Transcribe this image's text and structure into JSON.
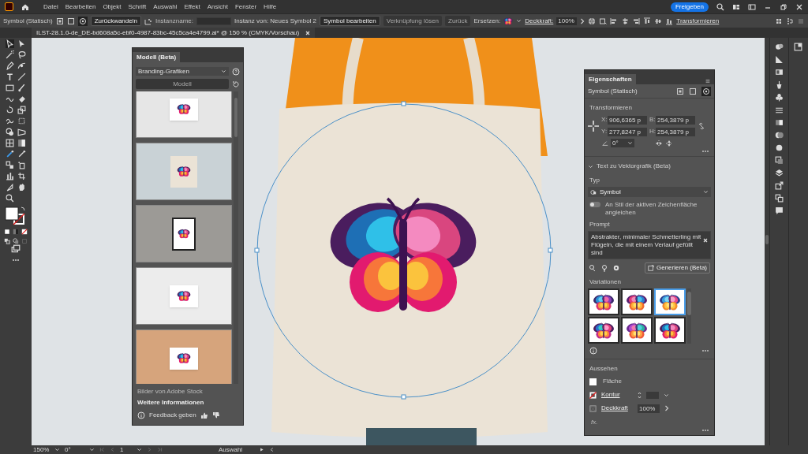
{
  "menu_bar": {
    "items": [
      "Datei",
      "Bearbeiten",
      "Objekt",
      "Schrift",
      "Auswahl",
      "Effekt",
      "Ansicht",
      "Fenster",
      "Hilfe"
    ],
    "share_button": "Freigeben"
  },
  "control_bar": {
    "object_type": "Symbol (Statisch)",
    "revert_button": "Zurückwandeln",
    "instance_name_label": "Instanzname:",
    "instance_of": "Instanz von: Neues Symbol 2",
    "edit_symbol_button": "Symbol bearbeiten",
    "break_link_button": {
      "label": "Verknüpfung lösen",
      "disabled": true
    },
    "reset_button": {
      "label": "Zurück",
      "disabled": true
    },
    "replace_label": "Ersetzen:",
    "opacity_label": "Deckkraft:",
    "opacity_value": "100%",
    "transform_link": "Transformieren"
  },
  "document_tab": {
    "title": "ILST-28.1.0-de_DE-bd608a5c-ebf0-4987-83bc-45c5ca4e4799.ai* @ 150 % (CMYK/Vorschau)"
  },
  "model_panel": {
    "title": "Modell (Beta)",
    "category": "Branding-Grafiken",
    "model_button": {
      "label": "Modell",
      "disabled": true
    },
    "mockups": [
      {
        "kind": "cards"
      },
      {
        "kind": "tote"
      },
      {
        "kind": "poster"
      },
      {
        "kind": "badge"
      },
      {
        "kind": "envelope"
      }
    ],
    "credit": "Bilder von Adobe Stock",
    "more_link": "Weitere Informationen",
    "feedback": "Feedback geben"
  },
  "properties_panel": {
    "title": "Eigenschaften",
    "object_type": "Symbol (Statisch)",
    "transform": {
      "heading": "Transformieren",
      "fields": [
        {
          "label": "X:",
          "value": "906,6365 p"
        },
        {
          "label": "B:",
          "value": "254,3879 p"
        },
        {
          "label": "Y:",
          "value": "277,8247 p"
        },
        {
          "label": "H:",
          "value": "254,3879 p"
        }
      ],
      "angle": "0°"
    },
    "text_to_vector": {
      "heading": "Text zu Vektorgrafik (Beta)",
      "expanded": true,
      "type_label": "Typ",
      "type_value": "Symbol",
      "match_style": {
        "label": "An Stil der aktiven Zeichenfläche angleichen",
        "on": false
      },
      "prompt_label": "Prompt",
      "prompt": "Abstrakter, minimaler Schmetterling mit Flügeln, die mit einem Verlauf gefüllt sind",
      "generate_button": "Generieren (Beta)",
      "variations_label": "Variationen",
      "variations": [
        {
          "selected": false
        },
        {
          "selected": false
        },
        {
          "selected": true
        },
        {
          "selected": false
        },
        {
          "selected": false
        },
        {
          "selected": false
        }
      ]
    },
    "appearance": {
      "heading": "Aussehen",
      "fill_label": "Fläche",
      "stroke_label": "Kontur",
      "opacity_label": "Deckkraft",
      "opacity_value": "100%",
      "fx": "fx."
    }
  },
  "status_bar": {
    "zoom": "150%",
    "rotation": "0°",
    "artboard": "1",
    "tool": "Auswahl"
  }
}
